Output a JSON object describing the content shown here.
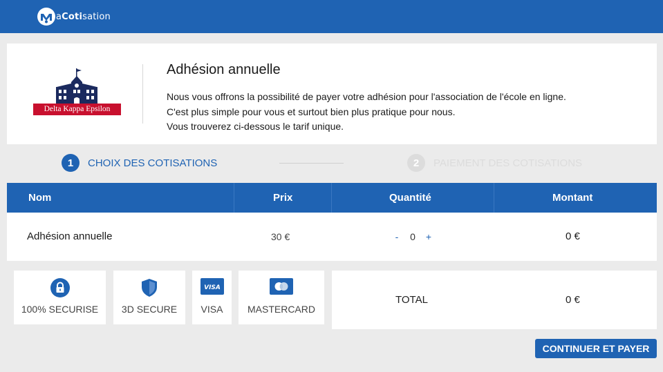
{
  "header": {
    "logo_text_part1": "a",
    "logo_text_bold": "Coti",
    "logo_text_part2": "sation",
    "brand_color": "#1f63b3"
  },
  "intro": {
    "org_name": "Delta Kappa Epsilon",
    "title": "Adhésion annuelle",
    "line1": "Nous vous offrons la possibilité de payer votre adhésion pour l'association de l'école en ligne.",
    "line2": "C'est plus simple pour vous et surtout bien plus pratique pour nous.",
    "line3": "Vous trouverez ci-dessous le tarif unique.",
    "org_color": "#c8102e",
    "crest_color": "#1b2a5e"
  },
  "steps": [
    {
      "num": "1",
      "label": "CHOIX DES COTISATIONS",
      "active": true
    },
    {
      "num": "2",
      "label": "PAIEMENT DES COTISATIONS",
      "active": false
    }
  ],
  "table": {
    "headers": {
      "name": "Nom",
      "price": "Prix",
      "quantity": "Quantité",
      "amount": "Montant"
    },
    "rows": [
      {
        "name": "Adhésion annuelle",
        "price": "30 €",
        "quantity": "0",
        "minus": "-",
        "plus": "+",
        "amount": "0 €"
      }
    ]
  },
  "badges": [
    {
      "label": "100% SECURISE",
      "icon": "lock-icon"
    },
    {
      "label": "3D SECURE",
      "icon": "shield-icon"
    },
    {
      "label": "VISA",
      "icon": "visa-card-icon",
      "card_text": "VISA"
    },
    {
      "label": "MASTERCARD",
      "icon": "mastercard-icon"
    }
  ],
  "totals": {
    "label": "TOTAL",
    "value": "0 €"
  },
  "actions": {
    "continue_label": "CONTINUER ET PAYER"
  }
}
